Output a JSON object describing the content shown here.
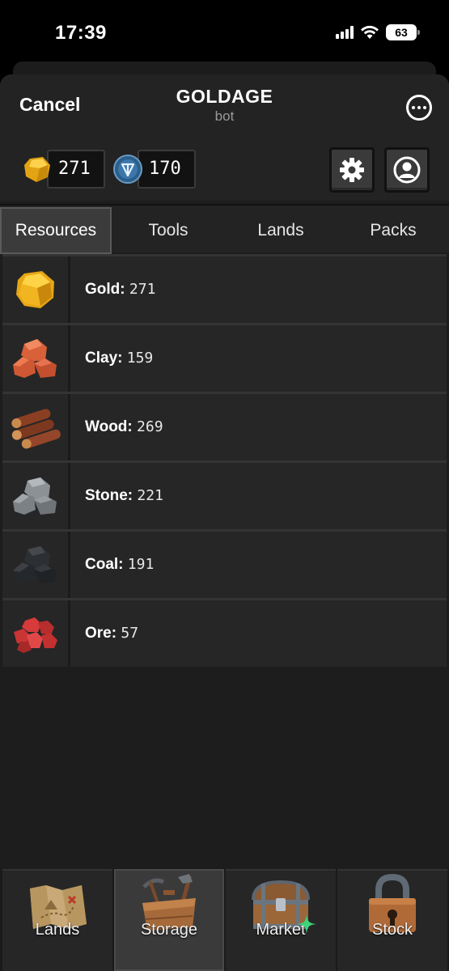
{
  "status_bar": {
    "time": "17:39",
    "battery": "63"
  },
  "header": {
    "cancel_label": "Cancel",
    "title": "GOLDAGE",
    "subtitle": "bot"
  },
  "balances": {
    "gold": "271",
    "ton": "170"
  },
  "tabs": [
    {
      "label": "Resources",
      "active": true
    },
    {
      "label": "Tools",
      "active": false
    },
    {
      "label": "Lands",
      "active": false
    },
    {
      "label": "Packs",
      "active": false
    }
  ],
  "resources": [
    {
      "label": "Gold:",
      "value": "271",
      "icon": "gold-nugget-icon"
    },
    {
      "label": "Clay:",
      "value": "159",
      "icon": "clay-icon"
    },
    {
      "label": "Wood:",
      "value": "269",
      "icon": "wood-logs-icon"
    },
    {
      "label": "Stone:",
      "value": "221",
      "icon": "stone-icon"
    },
    {
      "label": "Coal:",
      "value": "191",
      "icon": "coal-icon"
    },
    {
      "label": "Ore:",
      "value": "57",
      "icon": "ore-icon"
    }
  ],
  "bottom_nav": [
    {
      "label": "Lands",
      "icon": "treasure-map-icon",
      "active": false
    },
    {
      "label": "Storage",
      "icon": "toolbox-icon",
      "active": true
    },
    {
      "label": "Market",
      "icon": "chest-icon",
      "active": false
    },
    {
      "label": "Stock",
      "icon": "padlock-icon",
      "active": false
    }
  ],
  "colors": {
    "gold": "#f2b51e",
    "accent_green": "#3ed47a"
  }
}
